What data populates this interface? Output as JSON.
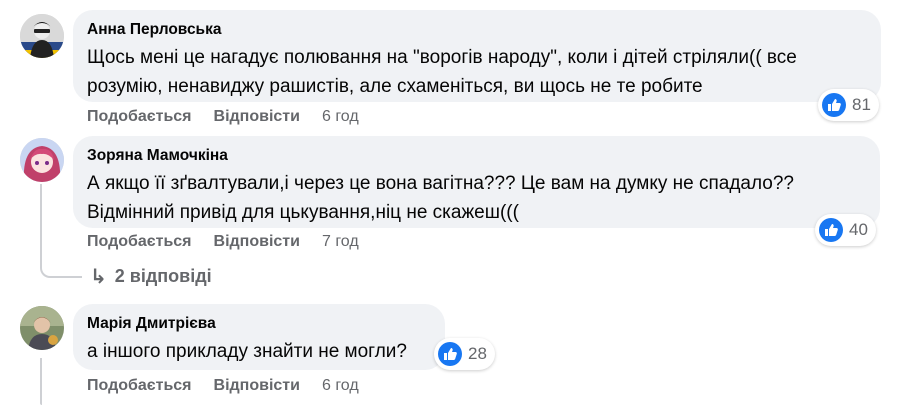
{
  "comments": [
    {
      "author": "Анна Перловська",
      "text_line1": "Щось мені це нагадує полювання на \"ворогів народу\", коли і дітей стріляли(( все",
      "text_line2": "розумію, ненавиджу рашистів, але схаменіться, ви щось не те робите",
      "like_label": "Подобається",
      "reply_label": "Відповісти",
      "time": "6 год",
      "reaction_count": "81",
      "avatar_icon": "avatar-anna"
    },
    {
      "author": "Зоряна Мамочкіна",
      "text_line1": "А якщо її зґвалтували,і через це вона вагітна??? Це вам на думку не спадало??",
      "text_line2": "Відмінний привід для цькування,ніц не скажеш(((",
      "like_label": "Подобається",
      "reply_label": "Відповісти",
      "time": "7 год",
      "reaction_count": "40",
      "avatar_icon": "avatar-zoryana"
    },
    {
      "author": "Марія Дмитрієва",
      "text_line1": "а іншого прикладу знайти не могли?",
      "like_label": "Подобається",
      "reply_label": "Відповісти",
      "time": "6 год",
      "reaction_count": "28",
      "avatar_icon": "avatar-mariya"
    }
  ],
  "replies": {
    "label": "2 відповіді",
    "icon": "reply-arrow-icon"
  },
  "colors": {
    "bubble": "#f0f2f5",
    "meta_text": "#65676b",
    "like_blue": "#1877f2"
  }
}
